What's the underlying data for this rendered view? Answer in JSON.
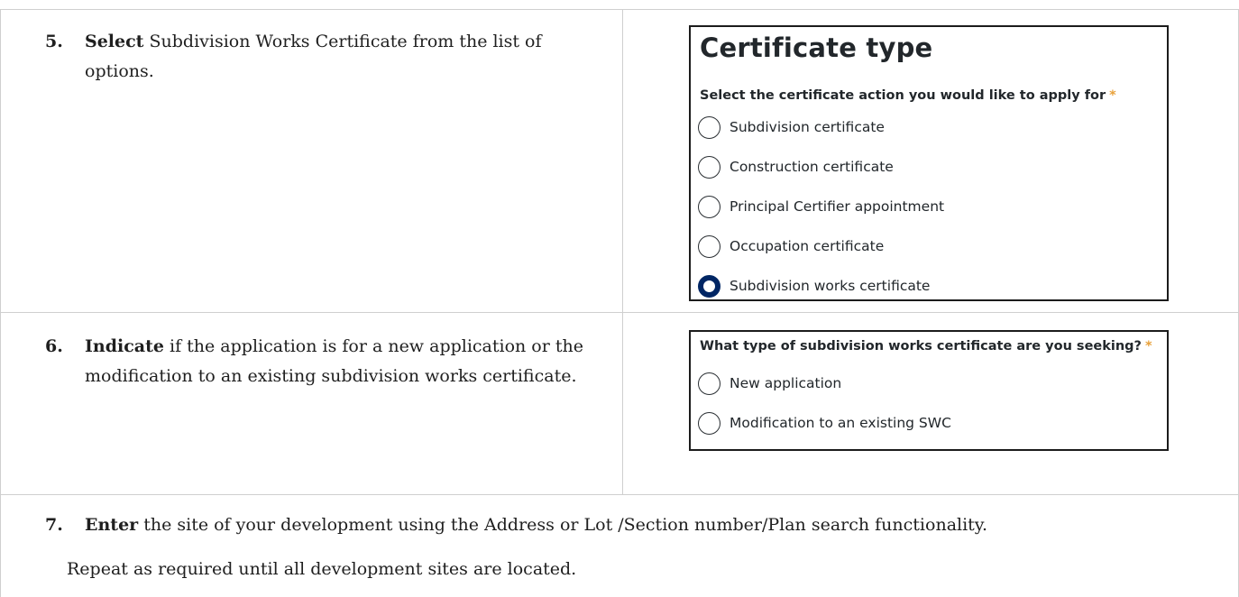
{
  "steps": [
    {
      "number": "5.",
      "keyword": "Select",
      "rest": " Subdivision Works Certificate from the list of options."
    },
    {
      "number": "6.",
      "keyword": "Indicate",
      "rest": " if the application is for a new application or the modification to an existing subdivision works certificate."
    },
    {
      "number": "7.",
      "keyword": "Enter",
      "rest": " the site of your development using the Address or Lot /Section number/Plan search functionality.",
      "note": "Repeat as required until all development sites are located."
    }
  ],
  "certificate_panel": {
    "title": "Certificate type",
    "question": "Select the certificate action you would like to apply for",
    "required_mark": "*",
    "options": [
      {
        "label": "Subdivision certificate",
        "selected": false
      },
      {
        "label": "Construction certificate",
        "selected": false
      },
      {
        "label": "Principal Certifier appointment",
        "selected": false
      },
      {
        "label": "Occupation certificate",
        "selected": false
      },
      {
        "label": "Subdivision works certificate",
        "selected": true
      }
    ]
  },
  "swc_panel": {
    "question": "What type of subdivision works certificate are you seeking?",
    "required_mark": "*",
    "options": [
      {
        "label": "New application",
        "selected": false
      },
      {
        "label": "Modification to an existing SWC",
        "selected": false
      }
    ]
  },
  "colors": {
    "selected_radio": "#002664",
    "required_star": "#e8a13a",
    "grid_lines": "#cfcfcf"
  }
}
